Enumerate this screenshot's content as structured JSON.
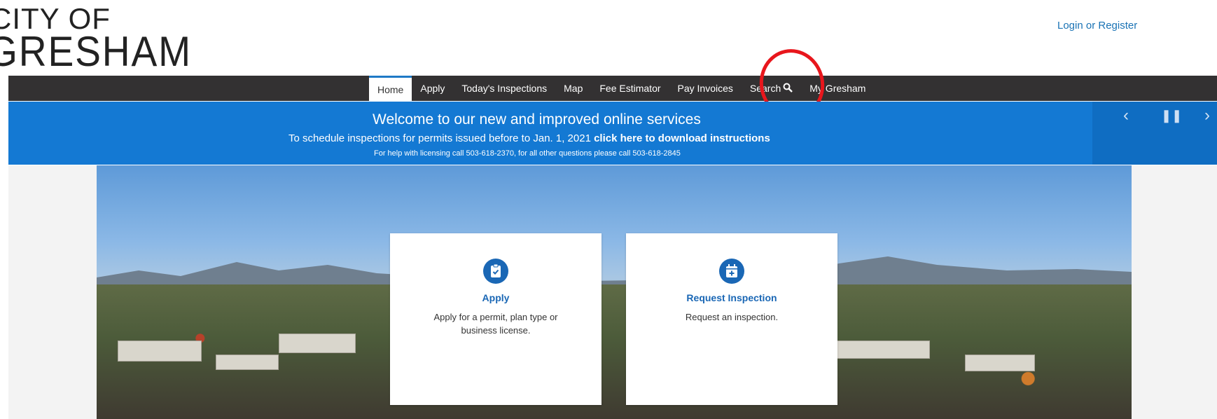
{
  "header": {
    "logo_line1": "CITY OF",
    "logo_line2": "GRESHAM",
    "login_link": "Login or Register"
  },
  "nav": {
    "items": [
      {
        "label": "Home",
        "active": true
      },
      {
        "label": "Apply"
      },
      {
        "label": "Today's Inspections"
      },
      {
        "label": "Map"
      },
      {
        "label": "Fee Estimator"
      },
      {
        "label": "Pay Invoices"
      },
      {
        "label": "Search",
        "icon": "search-icon"
      },
      {
        "label": "My Gresham"
      }
    ]
  },
  "banner": {
    "title": "Welcome to our new and improved online services",
    "line2_text": "To schedule inspections for permits issued before to Jan. 1, 2021 ",
    "line2_link": "click here to download instructions",
    "line3": "For help with licensing call 503-618-2370, for all other questions please call 503-618-2845",
    "controls": {
      "prev": "‹",
      "pause": "❚❚",
      "next": "›"
    }
  },
  "cards": [
    {
      "title": "Apply",
      "description": "Apply for a permit, plan type or business license.",
      "icon": "clipboard-check-icon"
    },
    {
      "title": "Request Inspection",
      "description": "Request an inspection.",
      "icon": "calendar-plus-icon"
    }
  ],
  "colors": {
    "nav_bg": "#333132",
    "banner_bg": "#1479d3",
    "accent": "#1a67b5",
    "annotation": "#e8161c"
  }
}
